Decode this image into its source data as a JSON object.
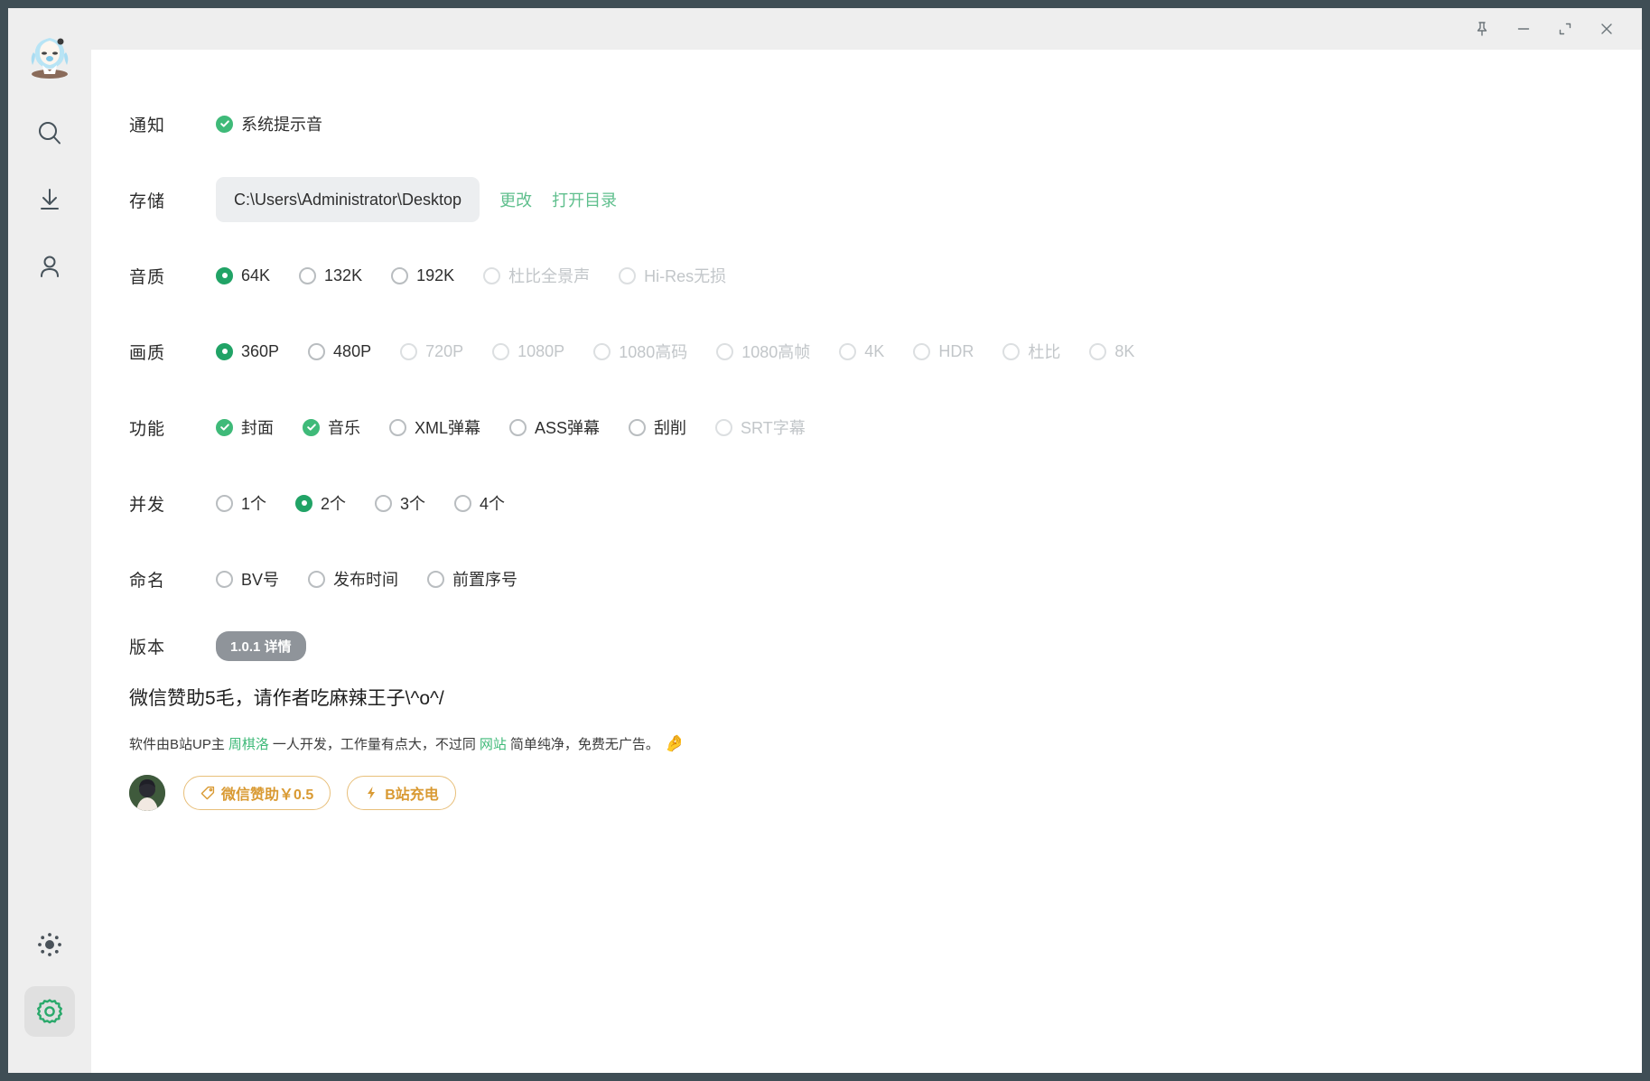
{
  "titlebar": {
    "buttons": [
      {
        "name": "pin-icon",
        "label": "置顶"
      },
      {
        "name": "minimize-icon",
        "label": "最小化"
      },
      {
        "name": "maximize-icon",
        "label": "最大化"
      },
      {
        "name": "close-icon",
        "label": "关闭"
      }
    ]
  },
  "sidebar": {
    "logo": {
      "name": "app-logo",
      "alt": "应用头像"
    },
    "items": [
      {
        "icon": "search-icon",
        "label": "搜索"
      },
      {
        "icon": "download-icon",
        "label": "下载"
      },
      {
        "icon": "user-icon",
        "label": "用户"
      }
    ],
    "bottom_items": [
      {
        "icon": "theme-sun-icon",
        "label": "主题",
        "active": false
      },
      {
        "icon": "gear-icon",
        "label": "设置",
        "active": true
      }
    ]
  },
  "settings": {
    "notification": {
      "label": "通知",
      "options": [
        {
          "label": "系统提示音",
          "checked": true,
          "disabled": false
        }
      ]
    },
    "storage": {
      "label": "存储",
      "path": "C:\\Users\\Administrator\\Desktop",
      "change_label": "更改",
      "open_label": "打开目录"
    },
    "audio_quality": {
      "label": "音质",
      "options": [
        {
          "label": "64K",
          "checked": true,
          "disabled": false
        },
        {
          "label": "132K",
          "checked": false,
          "disabled": false
        },
        {
          "label": "192K",
          "checked": false,
          "disabled": false
        },
        {
          "label": "杜比全景声",
          "checked": false,
          "disabled": true
        },
        {
          "label": "Hi-Res无损",
          "checked": false,
          "disabled": true
        }
      ]
    },
    "video_quality": {
      "label": "画质",
      "options": [
        {
          "label": "360P",
          "checked": true,
          "disabled": false
        },
        {
          "label": "480P",
          "checked": false,
          "disabled": false
        },
        {
          "label": "720P",
          "checked": false,
          "disabled": true
        },
        {
          "label": "1080P",
          "checked": false,
          "disabled": true
        },
        {
          "label": "1080高码",
          "checked": false,
          "disabled": true
        },
        {
          "label": "1080高帧",
          "checked": false,
          "disabled": true
        },
        {
          "label": "4K",
          "checked": false,
          "disabled": true
        },
        {
          "label": "HDR",
          "checked": false,
          "disabled": true
        },
        {
          "label": "杜比",
          "checked": false,
          "disabled": true
        },
        {
          "label": "8K",
          "checked": false,
          "disabled": true
        }
      ]
    },
    "features": {
      "label": "功能",
      "options": [
        {
          "label": "封面",
          "checked": true,
          "disabled": false
        },
        {
          "label": "音乐",
          "checked": true,
          "disabled": false
        },
        {
          "label": "XML弹幕",
          "checked": false,
          "disabled": false
        },
        {
          "label": "ASS弹幕",
          "checked": false,
          "disabled": false
        },
        {
          "label": "刮削",
          "checked": false,
          "disabled": false
        },
        {
          "label": "SRT字幕",
          "checked": false,
          "disabled": true
        }
      ]
    },
    "concurrency": {
      "label": "并发",
      "options": [
        {
          "label": "1个",
          "checked": false,
          "disabled": false
        },
        {
          "label": "2个",
          "checked": true,
          "disabled": false
        },
        {
          "label": "3个",
          "checked": false,
          "disabled": false
        },
        {
          "label": "4个",
          "checked": false,
          "disabled": false
        }
      ]
    },
    "naming": {
      "label": "命名",
      "options": [
        {
          "label": "BV号",
          "checked": false,
          "disabled": false
        },
        {
          "label": "发布时间",
          "checked": false,
          "disabled": false
        },
        {
          "label": "前置序号",
          "checked": false,
          "disabled": false
        }
      ]
    },
    "version": {
      "label": "版本",
      "badge": "1.0.1 详情"
    }
  },
  "sponsor": {
    "title": "微信赞助5毛，请作者吃麻辣王子\\^o^/",
    "desc_part1": "软件由B站UP主",
    "desc_link1": "周棋洛",
    "desc_part2": "一人开发，工作量有点大，不过同",
    "desc_link2": "网站",
    "desc_part3": "简单纯净，免费无广告。",
    "desc_emoji": "🤌",
    "avatar_name": "author-avatar",
    "buttons": [
      {
        "icon": "tag-icon",
        "label": "微信赞助￥0.5"
      },
      {
        "icon": "lightning-icon",
        "label": "B站充电"
      }
    ]
  },
  "colors": {
    "accent_green": "#21a366",
    "check_green": "#3fba79",
    "link_green": "#5fbf8d",
    "orange": "#d99a33",
    "frame": "#3f4e55",
    "sidebar_bg": "#eeeeee"
  }
}
